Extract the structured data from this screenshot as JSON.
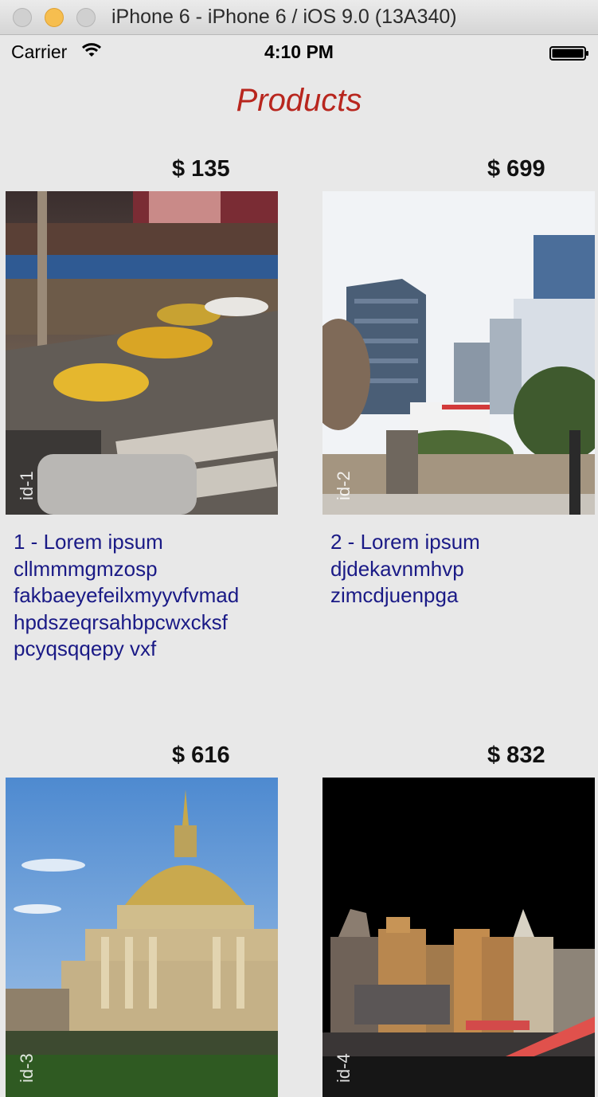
{
  "window": {
    "title": "iPhone 6 - iPhone 6 / iOS 9.0 (13A340)"
  },
  "status_bar": {
    "carrier": "Carrier",
    "time": "4:10 PM",
    "icons": [
      "wifi-icon",
      "battery-icon"
    ]
  },
  "page": {
    "title": "Products",
    "title_color": "#b8261e"
  },
  "products": [
    {
      "id": "id-1",
      "price": "$ 135",
      "description": "1 - Lorem ipsum\ncllmmmgmzosp\nfakbaeyefeilxmyyvfvmad\nhpdszeqrsahbpcwxcksf\npcyqsqqepy vxf"
    },
    {
      "id": "id-2",
      "price": "$ 699",
      "description": "2 - Lorem ipsum\ndjdekavnmhvp\nzimcdjuenpga"
    },
    {
      "id": "id-3",
      "price": "$ 616",
      "description": ""
    },
    {
      "id": "id-4",
      "price": "$ 832",
      "description": ""
    }
  ],
  "colors": {
    "background": "#e8e8e8",
    "price": "#111111",
    "description": "#1a1a86"
  }
}
